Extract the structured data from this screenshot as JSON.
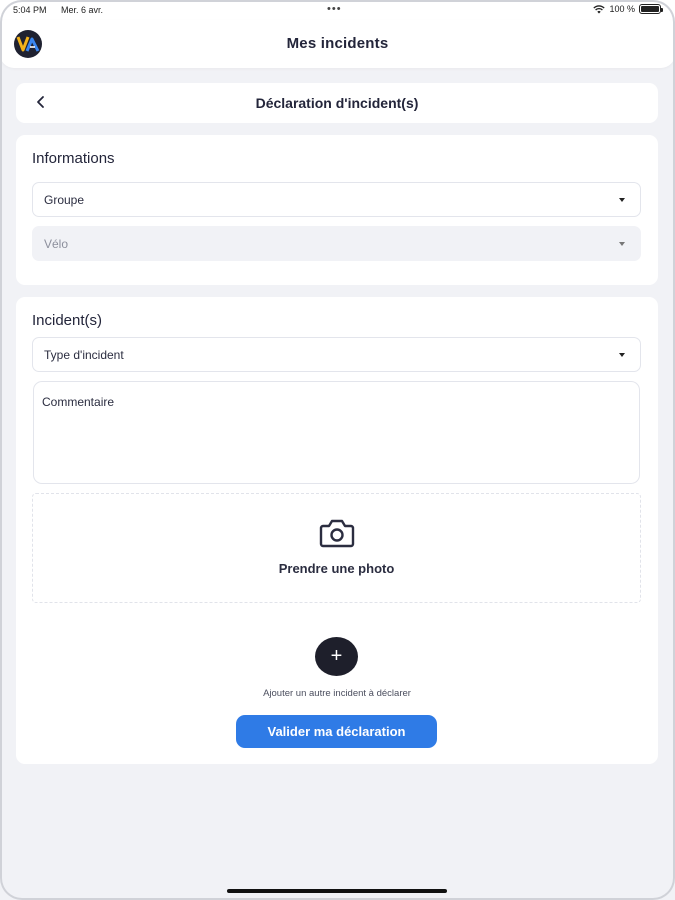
{
  "status_bar": {
    "time": "5:04 PM",
    "date": "Mer. 6 avr.",
    "dots": "•••",
    "battery": "100 %"
  },
  "app_bar": {
    "title": "Mes incidents",
    "logo_icon": "app-logo-icon"
  },
  "header": {
    "back_icon": "chevron-left-icon",
    "title": "Déclaration d'incident(s)"
  },
  "informations": {
    "title": "Informations",
    "group_select": "Groupe",
    "bike_select": "Vélo"
  },
  "incidents": {
    "title": "Incident(s)",
    "type_select": "Type d'incident",
    "comment_placeholder": "Commentaire",
    "photo_icon": "camera-icon",
    "photo_label": "Prendre une photo",
    "add_icon": "plus-icon",
    "add_label": "Ajouter un autre incident à déclarer",
    "submit_label": "Valider ma déclaration"
  },
  "colors": {
    "background": "#f1f2f6",
    "accent": "#2f7be6",
    "dark_button": "#1e1f2b"
  }
}
